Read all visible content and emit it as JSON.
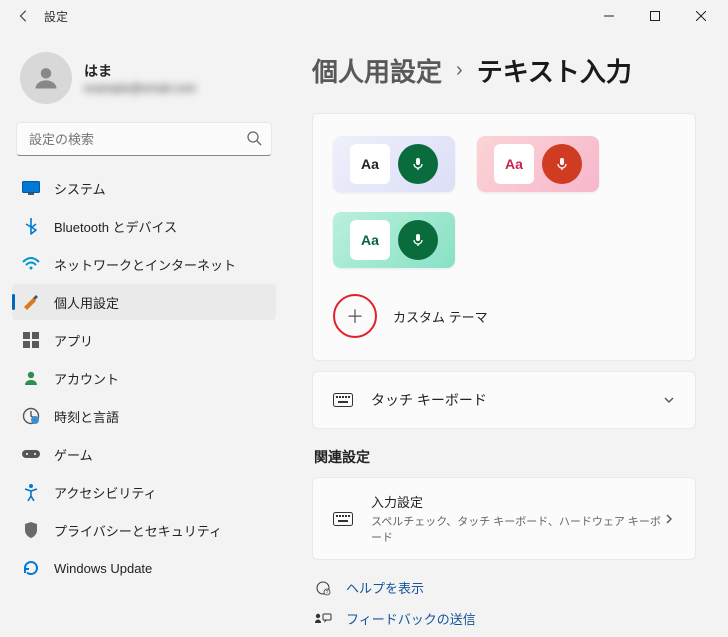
{
  "window": {
    "title": "設定"
  },
  "user": {
    "name": "はま",
    "email": "example@email.com"
  },
  "search": {
    "placeholder": "設定の検索"
  },
  "nav": {
    "items": [
      {
        "label": "システム"
      },
      {
        "label": "Bluetooth とデバイス"
      },
      {
        "label": "ネットワークとインターネット"
      },
      {
        "label": "個人用設定"
      },
      {
        "label": "アプリ"
      },
      {
        "label": "アカウント"
      },
      {
        "label": "時刻と言語"
      },
      {
        "label": "ゲーム"
      },
      {
        "label": "アクセシビリティ"
      },
      {
        "label": "プライバシーとセキュリティ"
      },
      {
        "label": "Windows Update"
      }
    ]
  },
  "breadcrumb": {
    "parent": "個人用設定",
    "sep": "›",
    "current": "テキスト入力"
  },
  "themes": {
    "sample_text": "Aa",
    "custom_label": "カスタム テーマ"
  },
  "touch_keyboard": {
    "label": "タッチ キーボード"
  },
  "related": {
    "header": "関連設定",
    "input_settings": {
      "title": "入力設定",
      "subtitle": "スペルチェック、タッチ キーボード、ハードウェア キーボード"
    }
  },
  "footer": {
    "help": "ヘルプを表示",
    "feedback": "フィードバックの送信"
  }
}
